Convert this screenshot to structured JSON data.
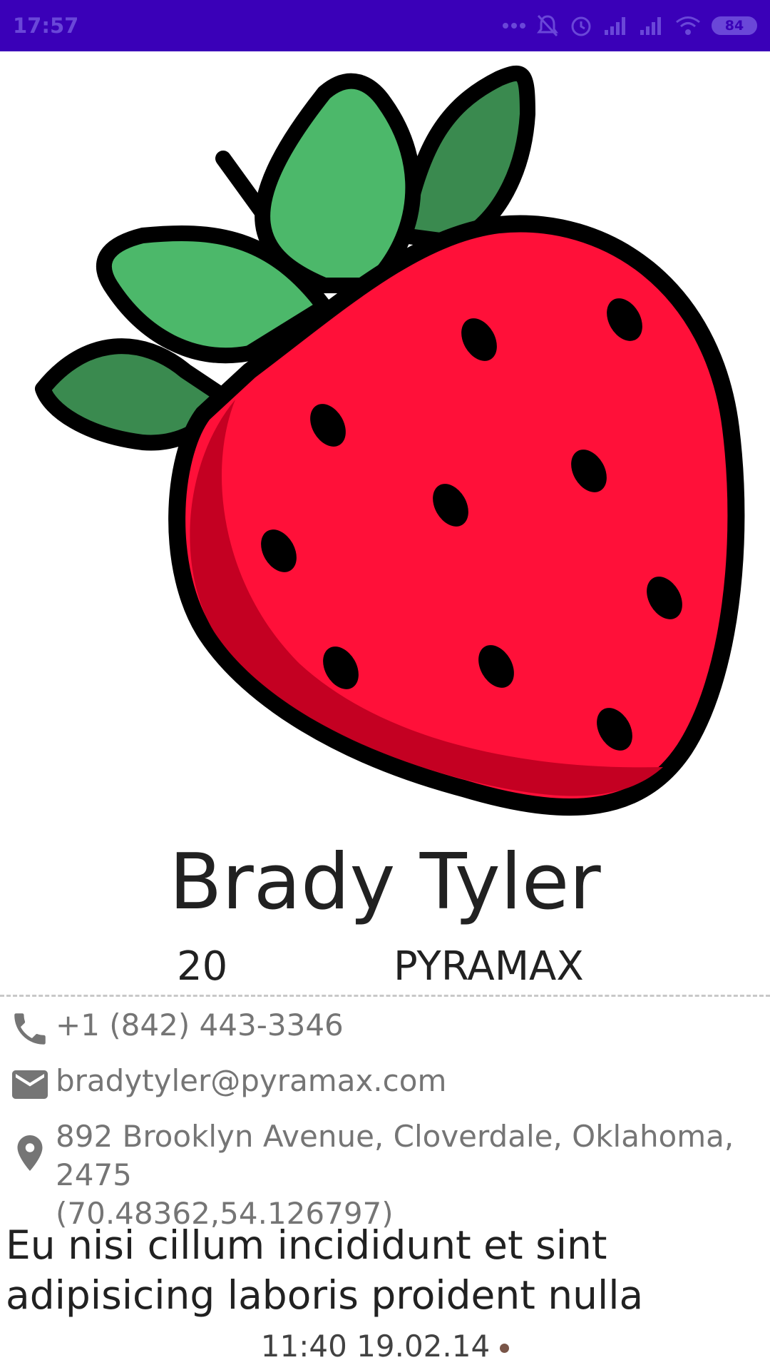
{
  "status_bar": {
    "time": "17:57",
    "battery": "84",
    "colors": {
      "background": "#3a00b8"
    },
    "icons": [
      "more-dots-icon",
      "mute-bell-icon",
      "alarm-icon",
      "signal-icon",
      "signal-icon",
      "wifi-icon",
      "battery-icon"
    ]
  },
  "profile": {
    "image": "strawberry",
    "name": "Brady Tyler",
    "age": "20",
    "company": "PYRAMAX",
    "phone": "+1 (842) 443-3346",
    "email": "bradytyler@pyramax.com",
    "address_line1": "892 Brooklyn Avenue, Cloverdale, Oklahoma, 2475",
    "address_line2": "(70.48362,54.126797)",
    "about_line1": "Eu nisi cillum incididunt et sint",
    "about_line2": "adipisicing laboris proident nulla",
    "registered": "11:40 19.02.14",
    "status_dot_color": "#795548"
  }
}
